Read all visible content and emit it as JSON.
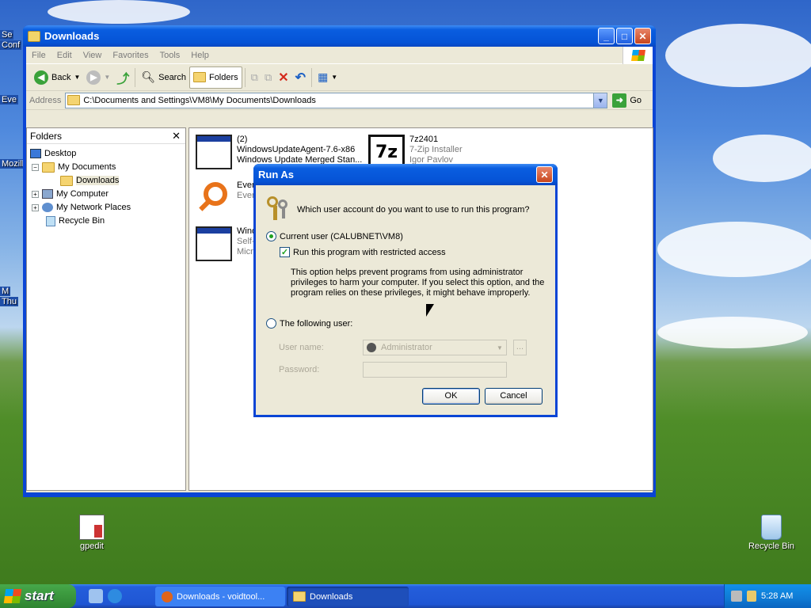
{
  "desktop": {
    "icons": [
      {
        "name": "gpedit",
        "label": "gpedit"
      },
      {
        "name": "recycle-bin",
        "label": "Recycle Bin"
      }
    ],
    "edge_labels": [
      "Se",
      "Conf",
      "Eve",
      "Mozill",
      "M",
      "Thu"
    ]
  },
  "explorer": {
    "title": "Downloads",
    "menu": [
      "File",
      "Edit",
      "View",
      "Favorites",
      "Tools",
      "Help"
    ],
    "toolbar": {
      "back": "Back",
      "search": "Search",
      "folders": "Folders"
    },
    "address": {
      "label": "Address",
      "path": "C:\\Documents and Settings\\VM8\\My Documents\\Downloads",
      "go": "Go"
    },
    "folders_pane": {
      "title": "Folders",
      "items": [
        {
          "label": "Desktop"
        },
        {
          "label": "My Documents"
        },
        {
          "label": "Downloads"
        },
        {
          "label": "My Computer"
        },
        {
          "label": "My Network Places"
        },
        {
          "label": "Recycle Bin"
        }
      ]
    },
    "files": [
      {
        "line1": "(2)",
        "line2": "WindowsUpdateAgent-7.6-x86",
        "line3": "Windows Update Merged Stan..."
      },
      {
        "line1": "7z2401",
        "line2": "7-Zip Installer",
        "line3": "Igor Pavlov"
      },
      {
        "line1": "Ever",
        "line2": "Ever",
        "line3": ""
      },
      {
        "line1": "Wind",
        "line2": "Self-",
        "line3": "Micro"
      }
    ]
  },
  "runas": {
    "title": "Run As",
    "question": "Which user account do you want to use to run this program?",
    "current_user": "Current user (CALUBNET\\VM8)",
    "restricted": "Run this program with restricted access",
    "description": [
      "This option helps prevent programs from using administrator",
      "privileges to harm your computer.  If you select this option, and the",
      "program relies on these privileges, it might behave improperly."
    ],
    "following_user": "The following user:",
    "username_label": "User name:",
    "username_value": "Administrator",
    "browse": "...",
    "password_label": "Password:",
    "ok": "OK",
    "cancel": "Cancel"
  },
  "taskbar": {
    "start": "start",
    "tasks": [
      "Downloads - voidtool...",
      "Downloads"
    ],
    "time": "5:28 AM"
  }
}
